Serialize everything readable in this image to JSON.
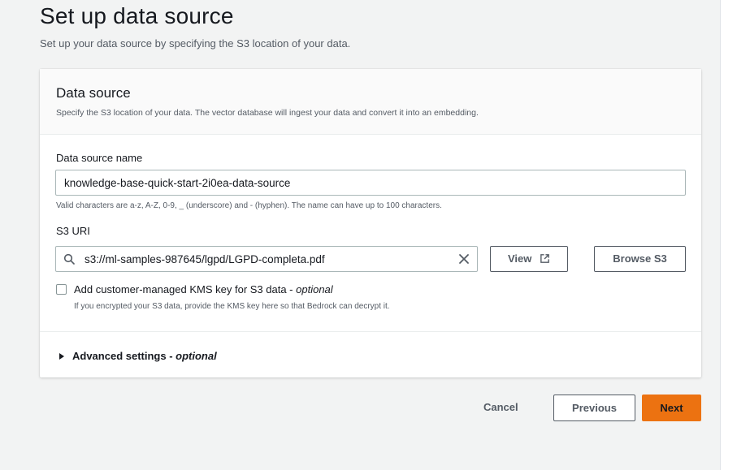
{
  "page": {
    "title": "Set up data source",
    "subtitle": "Set up your data source by specifying the S3 location of your data."
  },
  "card": {
    "title": "Data source",
    "description": "Specify the S3 location of your data. The vector database will ingest your data and convert it into an embedding.",
    "name_field": {
      "label": "Data source name",
      "value": "knowledge-base-quick-start-2i0ea-data-source",
      "hint": "Valid characters are a-z, A-Z, 0-9, _ (underscore) and - (hyphen). The name can have up to 100 characters."
    },
    "s3_field": {
      "label": "S3 URI",
      "value": "s3://ml-samples-987645/lgpd/LGPD-completa.pdf",
      "view_label": "View",
      "browse_label": "Browse S3"
    },
    "kms": {
      "label": "Add customer-managed KMS key for S3 data - ",
      "optional": "optional",
      "checked": false,
      "hint": "If you encrypted your S3 data, provide the KMS key here so that Bedrock can decrypt it."
    },
    "advanced": {
      "label": "Advanced settings - ",
      "optional": "optional"
    }
  },
  "footer": {
    "cancel_label": "Cancel",
    "previous_label": "Previous",
    "next_label": "Next"
  },
  "colors": {
    "primary": "#ec7211",
    "background": "#f2f3f3",
    "text": "#16191f"
  }
}
